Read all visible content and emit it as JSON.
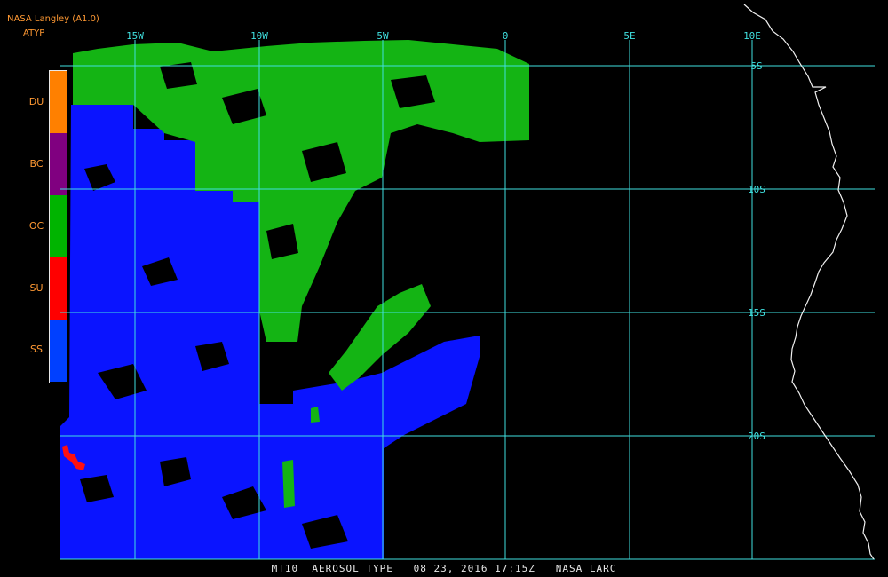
{
  "header": {
    "title": "NASA Langley (A1.0)",
    "product": "ATYP"
  },
  "legend": [
    {
      "code": "DU",
      "color": "#ff8000"
    },
    {
      "code": "BC",
      "color": "#800080"
    },
    {
      "code": "OC",
      "color": "#00b400"
    },
    {
      "code": "SU",
      "color": "#ff0000"
    },
    {
      "code": "SS",
      "color": "#0040ff"
    }
  ],
  "grid": {
    "lon_labels": [
      "15W",
      "10W",
      "5W",
      "0",
      "5E",
      "10E"
    ],
    "lat_labels": [
      "5S",
      "10S",
      "15S",
      "20S"
    ],
    "color": "#40e0e0"
  },
  "footer": {
    "text": "MT10  AEROSOL TYPE   08 23, 2016 17:15Z   NASA LARC"
  }
}
